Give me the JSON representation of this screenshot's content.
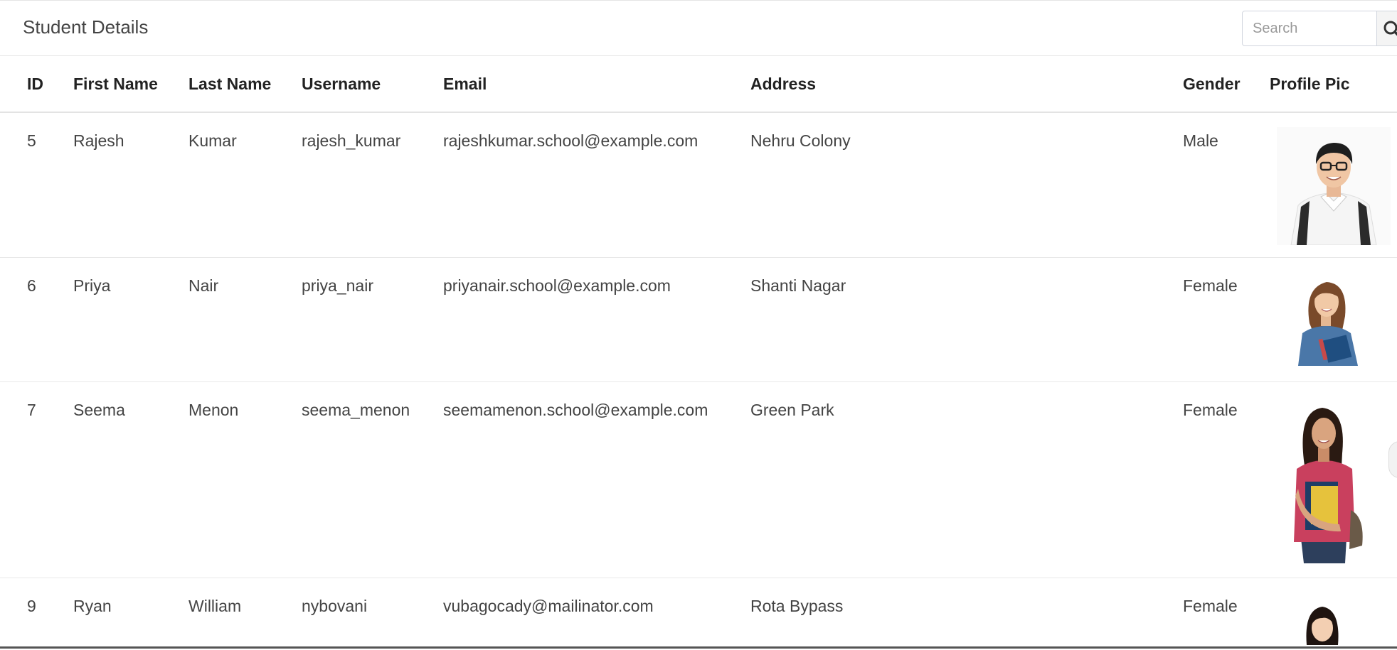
{
  "header": {
    "title": "Student Details",
    "search_placeholder": "Search",
    "search_icon": "search-icon"
  },
  "table": {
    "columns": [
      "ID",
      "First Name",
      "Last Name",
      "Username",
      "Email",
      "Address",
      "Gender",
      "Profile Pic"
    ],
    "rows": [
      {
        "id": "5",
        "first_name": "Rajesh",
        "last_name": "Kumar",
        "username": "rajesh_kumar",
        "email": "rajeshkumar.school@example.com",
        "address": "Nehru Colony",
        "gender": "Male",
        "pic": "male-student-glasses-photo"
      },
      {
        "id": "6",
        "first_name": "Priya",
        "last_name": "Nair",
        "username": "priya_nair",
        "email": "priyanair.school@example.com",
        "address": "Shanti Nagar",
        "gender": "Female",
        "pic": "female-student-denim-photo"
      },
      {
        "id": "7",
        "first_name": "Seema",
        "last_name": "Menon",
        "username": "seema_menon",
        "email": "seemamenon.school@example.com",
        "address": "Green Park",
        "gender": "Female",
        "pic": "female-student-books-photo"
      },
      {
        "id": "9",
        "first_name": "Ryan",
        "last_name": "William",
        "username": "nybovani",
        "email": "vubagocady@mailinator.com",
        "address": "Rota Bypass",
        "gender": "Female",
        "pic": "female-student-portrait-photo"
      }
    ]
  },
  "colors": {
    "header_border": "#e6e6e6",
    "row_border": "#e8e8e8",
    "text": "#444444",
    "heading_text": "#222222"
  }
}
